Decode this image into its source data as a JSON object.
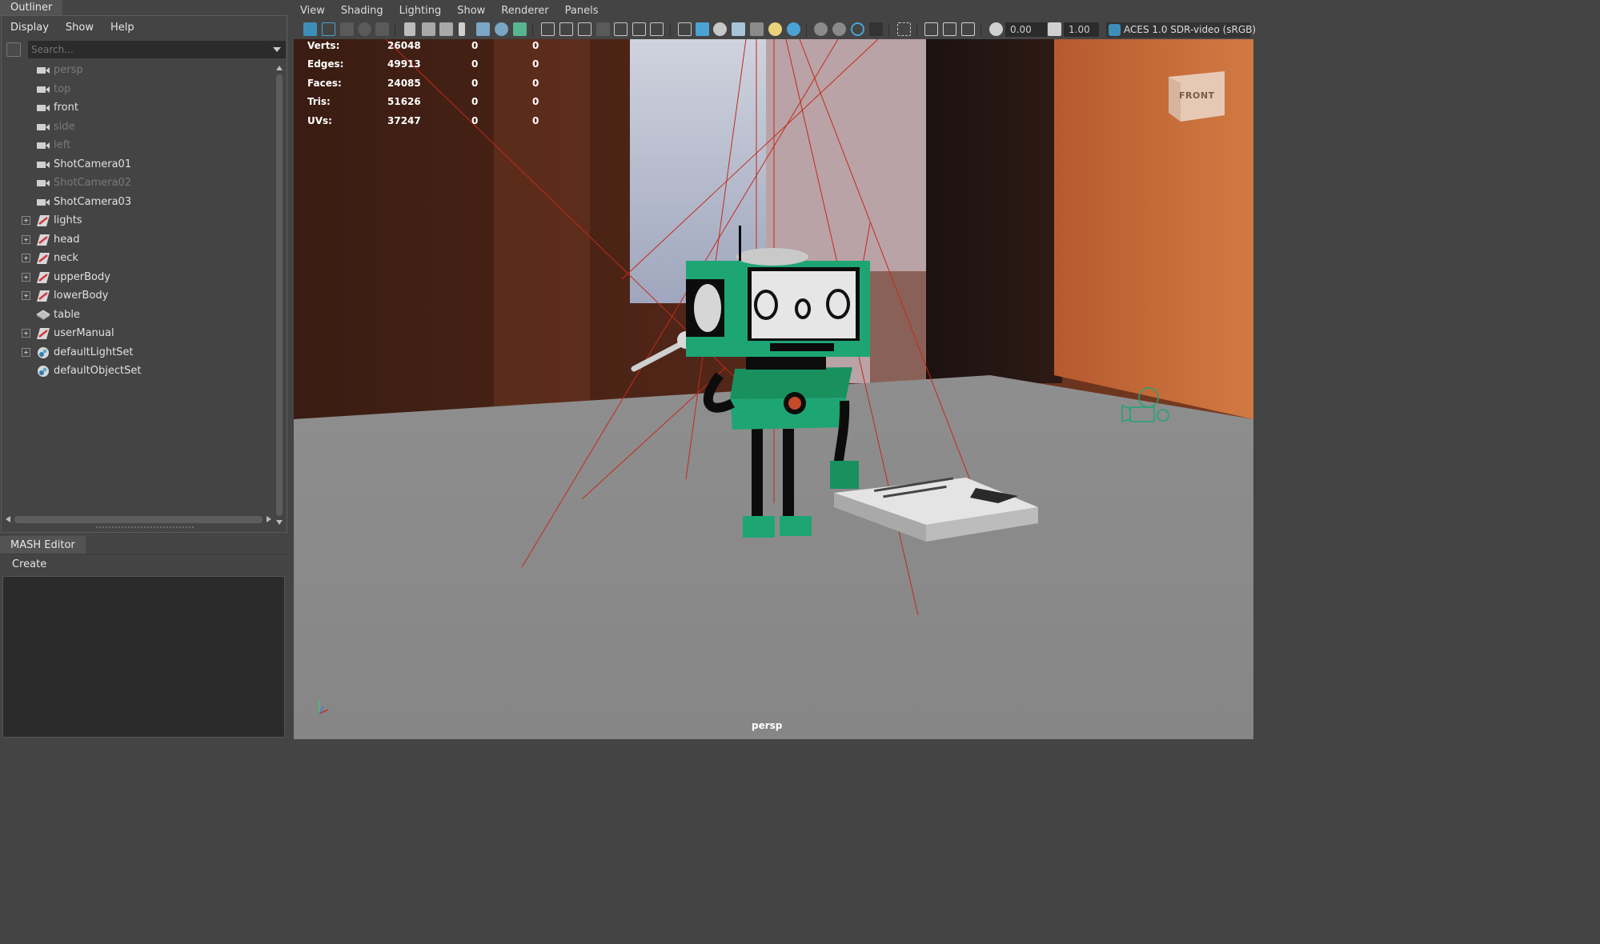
{
  "outliner": {
    "tab_label": "Outliner",
    "menu": [
      "Display",
      "Show",
      "Help"
    ],
    "search_placeholder": "Search...",
    "items": [
      {
        "label": "persp",
        "icon": "camera-icon",
        "dim": true,
        "expandable": false
      },
      {
        "label": "top",
        "icon": "camera-icon",
        "dim": true,
        "expandable": false
      },
      {
        "label": "front",
        "icon": "camera-icon",
        "dim": false,
        "expandable": false
      },
      {
        "label": "side",
        "icon": "camera-icon",
        "dim": true,
        "expandable": false
      },
      {
        "label": "left",
        "icon": "camera-icon",
        "dim": true,
        "expandable": false
      },
      {
        "label": "ShotCamera01",
        "icon": "camera-icon",
        "dim": false,
        "expandable": false
      },
      {
        "label": "ShotCamera02",
        "icon": "camera-icon",
        "dim": true,
        "expandable": false
      },
      {
        "label": "ShotCamera03",
        "icon": "camera-icon",
        "dim": false,
        "expandable": false
      },
      {
        "label": "lights",
        "icon": "group-transform-icon",
        "dim": false,
        "expandable": true
      },
      {
        "label": "head",
        "icon": "group-transform-icon",
        "dim": false,
        "expandable": true
      },
      {
        "label": "neck",
        "icon": "group-transform-icon",
        "dim": false,
        "expandable": true
      },
      {
        "label": "upperBody",
        "icon": "group-transform-icon",
        "dim": false,
        "expandable": true
      },
      {
        "label": "lowerBody",
        "icon": "group-transform-icon",
        "dim": false,
        "expandable": true
      },
      {
        "label": "table",
        "icon": "mesh-icon",
        "dim": false,
        "expandable": false
      },
      {
        "label": "userManual",
        "icon": "group-transform-icon",
        "dim": false,
        "expandable": true
      },
      {
        "label": "defaultLightSet",
        "icon": "set-icon",
        "dim": false,
        "expandable": true
      },
      {
        "label": "defaultObjectSet",
        "icon": "set-icon",
        "dim": false,
        "expandable": false
      }
    ]
  },
  "mash_editor": {
    "tab_label": "MASH Editor",
    "menu": [
      "Create"
    ]
  },
  "viewport_panel": {
    "menu": [
      "View",
      "Shading",
      "Lighting",
      "Show",
      "Renderer",
      "Panels"
    ],
    "toolbar": {
      "exposure_value": "0.00",
      "gamma_value": "1.00",
      "color_space_label": "ACES 1.0 SDR-video (sRGB)"
    },
    "heads_up": {
      "rows": [
        {
          "label": "Verts:",
          "v1": "26048",
          "v2": "0",
          "v3": "0"
        },
        {
          "label": "Edges:",
          "v1": "49913",
          "v2": "0",
          "v3": "0"
        },
        {
          "label": "Faces:",
          "v1": "24085",
          "v2": "0",
          "v3": "0"
        },
        {
          "label": "Tris:",
          "v1": "51626",
          "v2": "0",
          "v3": "0"
        },
        {
          "label": "UVs:",
          "v1": "37247",
          "v2": "0",
          "v3": "0"
        }
      ]
    },
    "camera_label": "persp",
    "view_cube_label": "FRONT",
    "colors": {
      "robot_green": "#1ea574",
      "light_line_red": "#c42a1a",
      "table_gray": "#8a8a8a",
      "accent_blue": "#3e8fb8"
    }
  }
}
